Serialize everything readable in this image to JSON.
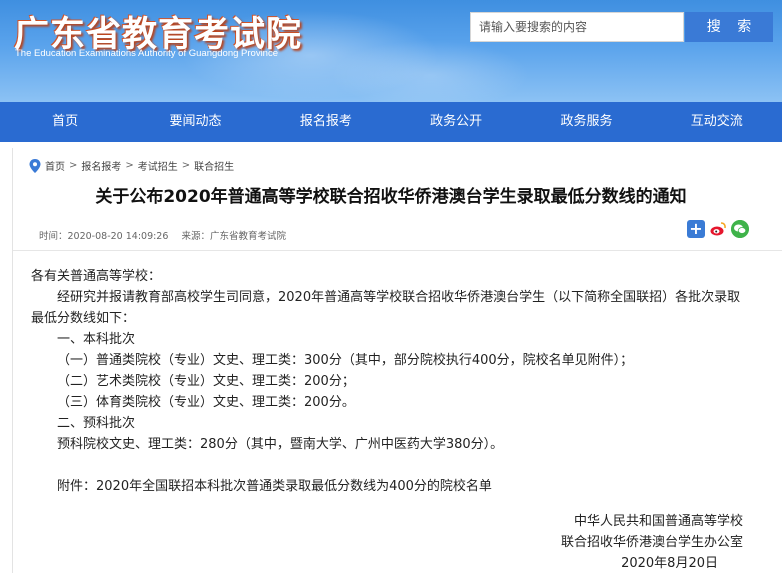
{
  "header": {
    "logo_cn": "广东省教育考试院",
    "logo_en": "The Education Examinations Authority of Guangdong Province",
    "search_placeholder": "请输入要搜索的内容",
    "search_button": "搜 索",
    "colors": {
      "header_blue": "#3f8fe0",
      "nav_blue": "#2a6bd1",
      "logo_shadow": "#b7431d"
    }
  },
  "nav": {
    "items": [
      "首页",
      "要闻动态",
      "报名报考",
      "政务公开",
      "政务服务",
      "互动交流"
    ]
  },
  "breadcrumb": {
    "icon": "location-pin-icon",
    "items": [
      "首页",
      "报名报考",
      "考试招生",
      "联合招生"
    ],
    "separator": ">"
  },
  "article": {
    "title": "关于公布2020年普通高等学校联合招收华侨港澳台学生录取最低分数线的通知",
    "time": "时间：2020-08-20 14:09:26",
    "source": "来源：广东省教育考试院",
    "share_icons": [
      "share-plus-icon",
      "weibo-icon",
      "wechat-icon"
    ],
    "salutation": "各有关普通高等学校：",
    "intro_line1": "经研究并报请教育部高校学生司同意，2020年普通高等学校联合招收华侨港澳台学生（以下简称全国联招）各批次录取",
    "intro_line2": "最低分数线如下：",
    "section1": "一、本科批次",
    "item1": "（一）普通类院校（专业）文史、理工类：300分（其中，部分院校执行400分，院校名单见附件）；",
    "item2": "（二）艺术类院校（专业）文史、理工类：200分；",
    "item3": "（三）体育类院校（专业）文史、理工类：200分。",
    "section2": "二、预科批次",
    "item4": "预科院校文史、理工类：280分（其中，暨南大学、广州中医药大学380分）。",
    "attachment": "附件：2020年全国联招本科批次普通类录取最低分数线为400分的院校名单",
    "sign1": "中华人民共和国普通高等学校",
    "sign2": "联合招收华侨港澳台学生办公室",
    "sign3": "2020年8月20日"
  }
}
